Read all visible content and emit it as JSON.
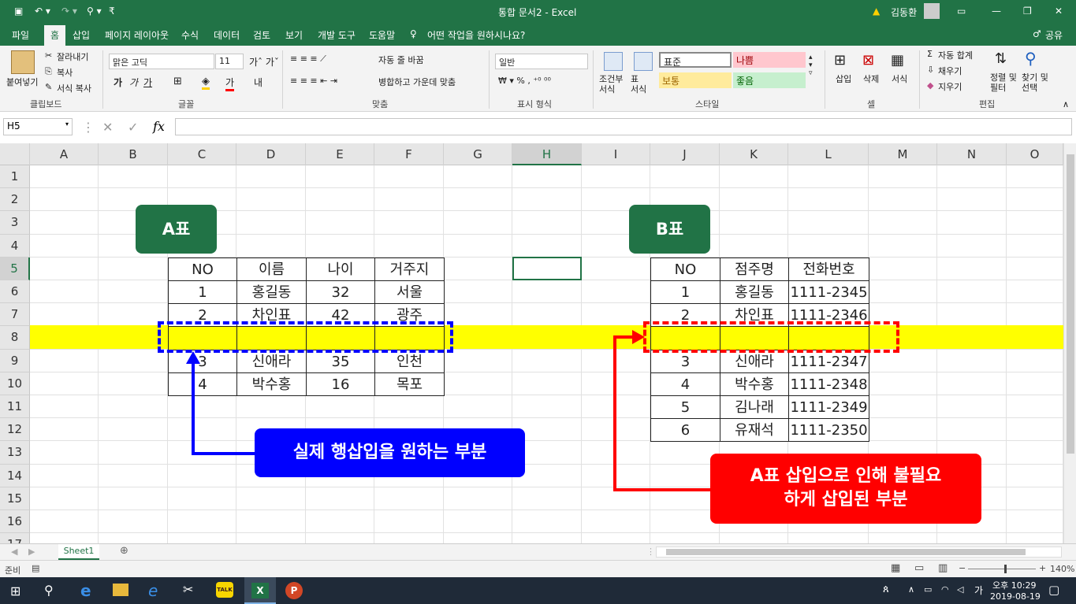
{
  "titlebar": {
    "title": "통합 문서2  -  Excel",
    "user": "김동환",
    "save_icon": "save-icon",
    "quick_access_more": "₹"
  },
  "tabs": [
    "파일",
    "홈",
    "삽입",
    "페이지 레이아웃",
    "수식",
    "데이터",
    "검토",
    "보기",
    "개발 도구",
    "도움말"
  ],
  "tell_me": "어떤 작업을 원하시나요?",
  "share": "공유",
  "ribbon": {
    "clipboard": {
      "paste": "붙여넣기",
      "cut": "잘라내기",
      "copy": "복사",
      "format_painter": "서식 복사",
      "label": "클립보드"
    },
    "font": {
      "name": "맑은 고딕",
      "size": "11",
      "label": "글꼴"
    },
    "alignment": {
      "wrap": "자동 줄 바꿈",
      "merge": "병합하고 가운데 맞춤",
      "label": "맞춤"
    },
    "number": {
      "format": "일반",
      "label": "표시 형식"
    },
    "styles": {
      "conditional": "조건부\n서식",
      "table": "표\n서식",
      "normal": "표준",
      "bad": "나쁨",
      "neutral": "보통",
      "good": "좋음",
      "label": "스타일"
    },
    "cells": {
      "insert": "삽입",
      "delete": "삭제",
      "format": "서식",
      "label": "셀"
    },
    "editing": {
      "autosum": "자동 합계",
      "fill": "채우기",
      "clear": "지우기",
      "sort": "정렬 및\n필터",
      "find": "찾기 및\n선택",
      "label": "편집"
    }
  },
  "formula_bar": {
    "name_box": "H5",
    "value": ""
  },
  "columns": [
    "A",
    "B",
    "C",
    "D",
    "E",
    "F",
    "G",
    "H",
    "I",
    "J",
    "K",
    "L",
    "M",
    "N",
    "O"
  ],
  "rows": [
    "1",
    "2",
    "3",
    "4",
    "5",
    "6",
    "7",
    "8",
    "9",
    "10",
    "11",
    "12",
    "13",
    "14",
    "15",
    "16",
    "17"
  ],
  "table_a": {
    "label": "A표",
    "headers": [
      "NO",
      "이름",
      "나이",
      "거주지"
    ],
    "rows": [
      [
        "1",
        "홍길동",
        "32",
        "서울"
      ],
      [
        "2",
        "차인표",
        "42",
        "광주"
      ],
      [
        "",
        "",
        "",
        ""
      ],
      [
        "3",
        "신애라",
        "35",
        "인천"
      ],
      [
        "4",
        "박수홍",
        "16",
        "목포"
      ]
    ]
  },
  "table_b": {
    "label": "B표",
    "headers": [
      "NO",
      "점주명",
      "전화번호"
    ],
    "rows": [
      [
        "1",
        "홍길동",
        "1111-2345"
      ],
      [
        "2",
        "차인표",
        "1111-2346"
      ],
      [
        "",
        "",
        ""
      ],
      [
        "3",
        "신애라",
        "1111-2347"
      ],
      [
        "4",
        "박수홍",
        "1111-2348"
      ],
      [
        "5",
        "김나래",
        "1111-2349"
      ],
      [
        "6",
        "유재석",
        "1111-2350"
      ]
    ]
  },
  "callout_blue": "실제 행삽입을 원하는 부분",
  "callout_red_1": "A표 삽입으로 인해 불필요",
  "callout_red_2": "하게 삽입된 부분",
  "sheet_tab": "Sheet1",
  "status": {
    "ready": "준비",
    "zoom": "140%"
  },
  "taskbar": {
    "time": "오후 10:29",
    "date": "2019-08-19",
    "ime": "가"
  },
  "colors": {
    "excel_green": "#217346",
    "highlight": "#ffff00",
    "blue": "#0000ff",
    "red": "#ff0000",
    "label_green": "#217346"
  }
}
